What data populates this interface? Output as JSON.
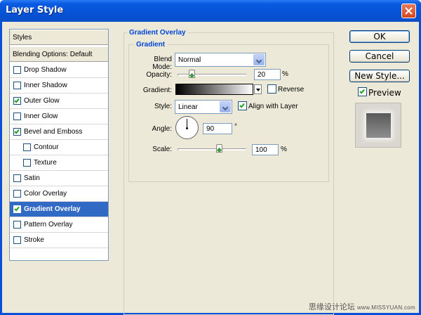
{
  "window": {
    "title": "Layer Style"
  },
  "styles_list": {
    "header": "Styles",
    "blending_options": "Blending Options: Default",
    "items": [
      {
        "label": "Drop Shadow",
        "checked": false,
        "indent": false,
        "selected": false
      },
      {
        "label": "Inner Shadow",
        "checked": false,
        "indent": false,
        "selected": false
      },
      {
        "label": "Outer Glow",
        "checked": true,
        "indent": false,
        "selected": false
      },
      {
        "label": "Inner Glow",
        "checked": false,
        "indent": false,
        "selected": false
      },
      {
        "label": "Bevel and Emboss",
        "checked": true,
        "indent": false,
        "selected": false
      },
      {
        "label": "Contour",
        "checked": false,
        "indent": true,
        "selected": false
      },
      {
        "label": "Texture",
        "checked": false,
        "indent": true,
        "selected": false
      },
      {
        "label": "Satin",
        "checked": false,
        "indent": false,
        "selected": false
      },
      {
        "label": "Color Overlay",
        "checked": false,
        "indent": false,
        "selected": false
      },
      {
        "label": "Gradient Overlay",
        "checked": true,
        "indent": false,
        "selected": true
      },
      {
        "label": "Pattern Overlay",
        "checked": false,
        "indent": false,
        "selected": false
      },
      {
        "label": "Stroke",
        "checked": false,
        "indent": false,
        "selected": false
      }
    ]
  },
  "panel": {
    "section_title": "Gradient Overlay",
    "group_title": "Gradient",
    "blend_mode": {
      "label": "Blend Mode:",
      "value": "Normal"
    },
    "opacity": {
      "label": "Opacity:",
      "value": "20",
      "unit": "%",
      "level": 0.2
    },
    "gradient": {
      "label": "Gradient:",
      "start_color": "#000000",
      "end_color": "#ffffff"
    },
    "reverse": {
      "label": "Reverse",
      "checked": false
    },
    "style": {
      "label": "Style:",
      "value": "Linear"
    },
    "align_with_layer": {
      "label": "Align with Layer",
      "checked": true
    },
    "angle": {
      "label": "Angle:",
      "value": "90",
      "unit": "°",
      "degrees": 90
    },
    "scale": {
      "label": "Scale:",
      "value": "100",
      "unit": "%",
      "level": 0.6
    }
  },
  "buttons": {
    "ok": "OK",
    "cancel": "Cancel",
    "new_style": "New Style...",
    "preview": {
      "label": "Preview",
      "checked": true
    }
  },
  "watermark": {
    "text": "思缘设计论坛",
    "url": "www.MISSYUAN.com"
  }
}
